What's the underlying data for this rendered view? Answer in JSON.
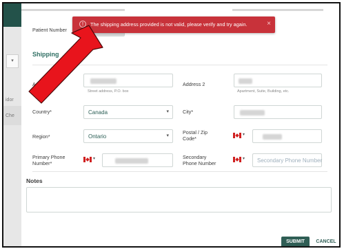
{
  "background": {
    "sidebar_texts": [
      "idor",
      "Che"
    ]
  },
  "form": {
    "patient_number_label": "Patient Number",
    "section_title": "Shipping",
    "address_label": "Address",
    "address_hint": "Street address, P.O. box",
    "address2_label": "Address 2",
    "address2_hint": "Apartment, Suite, Building, etc.",
    "country_label": "Country*",
    "country_value": "Canada",
    "city_label": "City*",
    "region_label": "Region*",
    "region_value": "Ontario",
    "postal_label_line1": "Postal / Zip",
    "postal_label_line2": "Code*",
    "primary_phone_label_line1": "Primary Phone",
    "primary_phone_label_line2": "Number*",
    "secondary_phone_label_line1": "Secondary",
    "secondary_phone_label_line2": "Phone Number",
    "secondary_phone_placeholder": "Secondary Phone Number",
    "notes_label": "Notes"
  },
  "actions": {
    "submit_label": "SUBMIT",
    "cancel_label": "CANCEL"
  },
  "toast": {
    "message": "The shipping address provided is not valid, please verify and try again.",
    "close_glyph": "×",
    "icon_glyph": "!"
  },
  "icons": {
    "chevron": "▾",
    "flag_country": "Canada"
  },
  "colors": {
    "accent": "#2f5e55",
    "toast_bg": "#c8323a",
    "arrow": "#e8141c"
  }
}
